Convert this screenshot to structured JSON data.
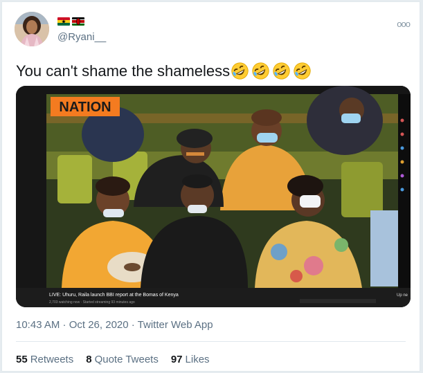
{
  "user": {
    "handle": "@Ryani__",
    "flags": [
      "ghana-flag",
      "kenya-flag"
    ]
  },
  "tweet": {
    "text": "You can't shame the shameless",
    "emoji_count": 4,
    "emoji": "rolling-on-floor-laughing"
  },
  "media": {
    "logo": "NATION",
    "caption": "LIVE: Uhuru, Raila launch BBI report at the Bomas of Kenya",
    "subcaption": "2,703 watching now · Started streaming 93 minutes ago",
    "side_label": "Up ne"
  },
  "meta": {
    "timestamp": "10:43 AM · Oct 26, 2020 · Twitter Web App"
  },
  "stats": {
    "retweets_count": "55",
    "retweets_label": "Retweets",
    "quotes_count": "8",
    "quotes_label": "Quote Tweets",
    "likes_count": "97",
    "likes_label": "Likes"
  },
  "colors": {
    "link_gray": "#5b7083",
    "nation_orange": "#f47b20",
    "mustard": "#e8a23a"
  }
}
